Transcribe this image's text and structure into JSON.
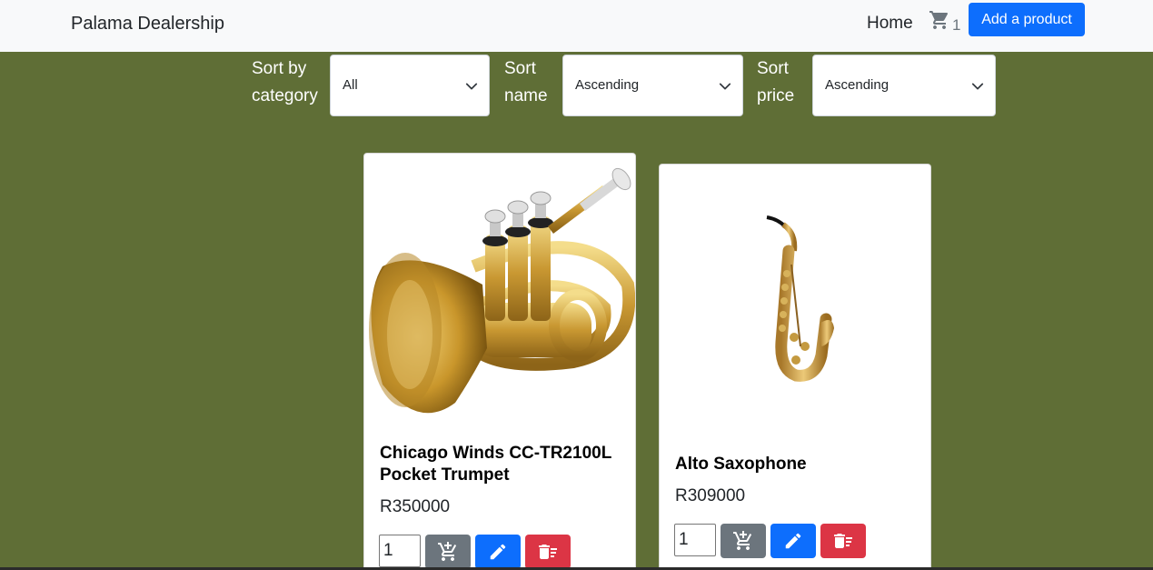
{
  "navbar": {
    "brand": "Palama Dealership",
    "home": "Home",
    "cart_icon": "cart-icon",
    "cart_count": "1",
    "add_product": "Add a product"
  },
  "filters": {
    "category": {
      "label_line1": "Sort by",
      "label_line2": "category",
      "value": "All"
    },
    "name": {
      "label_line1": "Sort",
      "label_line2": "name",
      "value": "Ascending"
    },
    "price": {
      "label_line1": "Sort",
      "label_line2": "price",
      "value": "Ascending"
    }
  },
  "products": [
    {
      "title_line1": "Chicago Winds CC-TR2100L",
      "title_line2": "Pocket Trumpet",
      "price": "R350000",
      "qty": "1",
      "image": "trumpet-image"
    },
    {
      "title_line1": "Alto Saxophone",
      "title_line2": "",
      "price": "R309000",
      "qty": "1",
      "image": "saxophone-image"
    }
  ],
  "colors": {
    "background": "#5f6e36",
    "navbar": "#f8f9fa",
    "primary": "#0d6efd",
    "secondary": "#6c757d",
    "danger": "#dc3545"
  }
}
